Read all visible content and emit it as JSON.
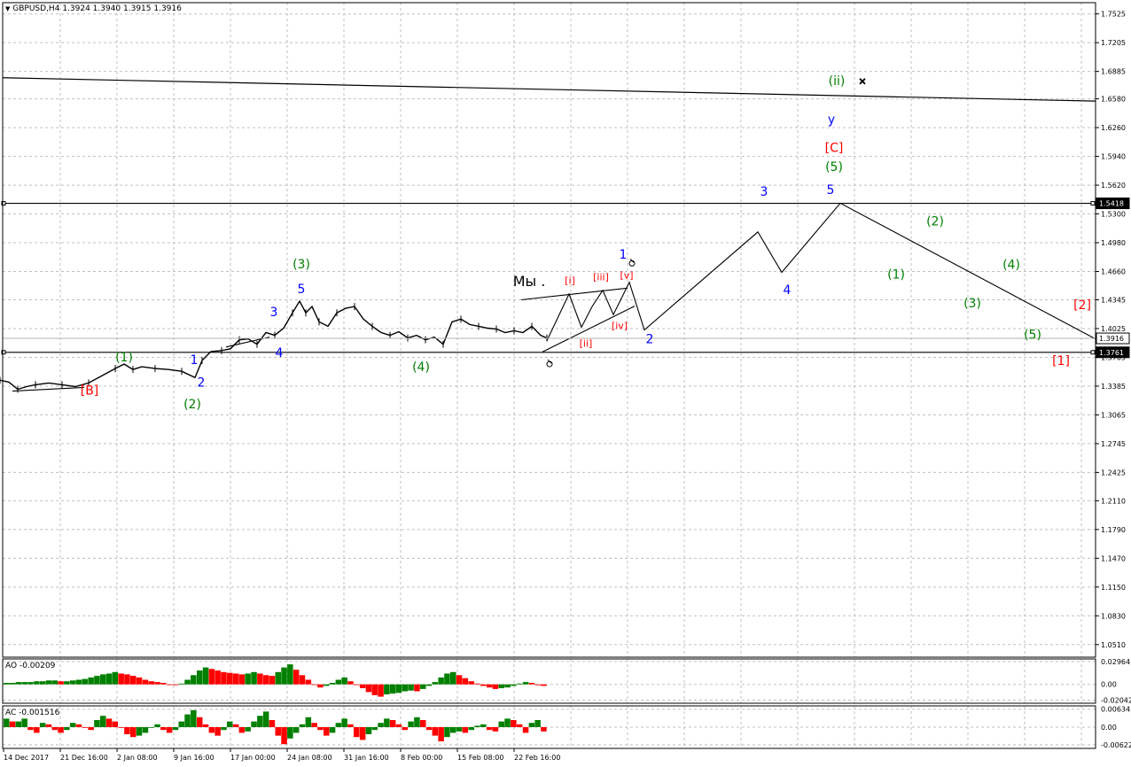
{
  "header": {
    "symbol": "GBPUSD,H4",
    "ohlc": "1.3924 1.3940 1.3915 1.3916"
  },
  "chart_data": [
    {
      "type": "line",
      "panel": "main",
      "ylim": [
        1.037,
        1.765
      ],
      "y_ticks": [
        "1.7525",
        "1.7205",
        "1.6885",
        "1.6580",
        "1.6260",
        "1.5940",
        "1.5620",
        "1.5300",
        "1.4980",
        "1.4660",
        "1.4345",
        "1.4025",
        "1.3705",
        "1.3385",
        "1.3065",
        "1.2745",
        "1.2425",
        "1.2110",
        "1.1790",
        "1.1470",
        "1.1150",
        "1.0830",
        "1.0510"
      ],
      "grid": true,
      "colors": {
        "background": "#ffffff",
        "grid": "#c0c0c0",
        "price": "#000000",
        "blue": "#0000ff",
        "green": "#008000",
        "red": "#ff0000"
      },
      "price_points": [
        [
          0,
          1.345
        ],
        [
          10,
          1.343
        ],
        [
          20,
          1.335
        ],
        [
          30,
          1.338
        ],
        [
          40,
          1.34
        ],
        [
          55,
          1.342
        ],
        [
          70,
          1.34
        ],
        [
          85,
          1.338
        ],
        [
          100,
          1.342
        ],
        [
          115,
          1.35
        ],
        [
          130,
          1.358
        ],
        [
          140,
          1.363
        ],
        [
          150,
          1.357
        ],
        [
          160,
          1.36
        ],
        [
          175,
          1.358
        ],
        [
          190,
          1.357
        ],
        [
          205,
          1.355
        ],
        [
          220,
          1.348
        ],
        [
          228,
          1.367
        ],
        [
          238,
          1.377
        ],
        [
          250,
          1.378
        ],
        [
          260,
          1.38
        ],
        [
          270,
          1.39
        ],
        [
          280,
          1.391
        ],
        [
          290,
          1.385
        ],
        [
          300,
          1.398
        ],
        [
          310,
          1.395
        ],
        [
          320,
          1.403
        ],
        [
          330,
          1.42
        ],
        [
          338,
          1.433
        ],
        [
          345,
          1.42
        ],
        [
          352,
          1.427
        ],
        [
          360,
          1.41
        ],
        [
          370,
          1.405
        ],
        [
          380,
          1.42
        ],
        [
          390,
          1.425
        ],
        [
          400,
          1.427
        ],
        [
          410,
          1.413
        ],
        [
          420,
          1.405
        ],
        [
          430,
          1.398
        ],
        [
          440,
          1.395
        ],
        [
          450,
          1.399
        ],
        [
          460,
          1.392
        ],
        [
          470,
          1.395
        ],
        [
          480,
          1.39
        ],
        [
          490,
          1.393
        ],
        [
          500,
          1.385
        ],
        [
          510,
          1.41
        ],
        [
          520,
          1.413
        ],
        [
          530,
          1.407
        ],
        [
          540,
          1.405
        ],
        [
          550,
          1.403
        ],
        [
          560,
          1.402
        ],
        [
          570,
          1.398
        ],
        [
          580,
          1.4
        ],
        [
          590,
          1.398
        ],
        [
          600,
          1.405
        ],
        [
          610,
          1.395
        ],
        [
          617,
          1.392
        ]
      ],
      "projection_path": [
        [
          617,
          1.389
        ],
        [
          642,
          1.441
        ],
        [
          656,
          1.404
        ],
        [
          668,
          1.427
        ],
        [
          680,
          1.445
        ],
        [
          692,
          1.418
        ],
        [
          710,
          1.454
        ],
        [
          727,
          1.401
        ],
        [
          855,
          1.51
        ],
        [
          882,
          1.465
        ],
        [
          948,
          1.542
        ],
        [
          1236,
          1.391
        ]
      ],
      "channel_lines": [
        [
          [
            588,
            1.4345
          ],
          [
            708,
            1.4475
          ]
        ],
        [
          [
            612,
            1.3765
          ],
          [
            716,
            1.4275
          ]
        ],
        [
          [
            14,
            1.333
          ],
          [
            95,
            1.337
          ]
        ],
        [
          [
            255,
            1.382
          ],
          [
            304,
            1.393
          ]
        ]
      ],
      "long_trend_line": [
        [
          3,
          1.6815
        ],
        [
          1236,
          1.6555
        ]
      ],
      "horizontal_levels": [
        {
          "value": 1.5418,
          "label": "1.5418",
          "style": "dark"
        },
        {
          "value": 1.3916,
          "label": "1.3916",
          "style": "current"
        },
        {
          "value": 1.3761,
          "label": "1.3761",
          "style": "dark"
        }
      ],
      "wave_labels": [
        {
          "text": "[B]",
          "color": "red",
          "x": 101,
          "y": 1.333
        },
        {
          "text": "(1)",
          "color": "green",
          "x": 140,
          "y": 1.37
        },
        {
          "text": "(2)",
          "color": "green",
          "x": 217,
          "y": 1.318
        },
        {
          "text": "1",
          "color": "blue",
          "x": 219,
          "y": 1.367
        },
        {
          "text": "2",
          "color": "blue",
          "x": 227,
          "y": 1.342
        },
        {
          "text": "3",
          "color": "blue",
          "x": 309,
          "y": 1.42
        },
        {
          "text": "4",
          "color": "blue",
          "x": 315,
          "y": 1.375
        },
        {
          "text": "5",
          "color": "blue",
          "x": 340,
          "y": 1.446
        },
        {
          "text": "(3)",
          "color": "green",
          "x": 340,
          "y": 1.4735
        },
        {
          "text": "(4)",
          "color": "green",
          "x": 475,
          "y": 1.359
        },
        {
          "text": "Мы .",
          "color": "black",
          "x": 597,
          "y": 1.454
        },
        {
          "text": "[i]",
          "color": "red",
          "x": 643,
          "y": 1.455
        },
        {
          "text": "[iii]",
          "color": "red",
          "x": 678,
          "y": 1.459
        },
        {
          "text": "[v]",
          "color": "red",
          "x": 707,
          "y": 1.461
        },
        {
          "text": "[iv]",
          "color": "red",
          "x": 699,
          "y": 1.405
        },
        {
          "text": "[ii]",
          "color": "red",
          "x": 661,
          "y": 1.385
        },
        {
          "text": "1",
          "color": "blue",
          "x": 703,
          "y": 1.484
        },
        {
          "text": "2",
          "color": "blue",
          "x": 733,
          "y": 1.39
        },
        {
          "text": "3",
          "color": "blue",
          "x": 862,
          "y": 1.554
        },
        {
          "text": "4",
          "color": "blue",
          "x": 888,
          "y": 1.445
        },
        {
          "text": "5",
          "color": "blue",
          "x": 937,
          "y": 1.556
        },
        {
          "text": "(5)",
          "color": "green",
          "x": 941,
          "y": 1.582
        },
        {
          "text": "[C]",
          "color": "red",
          "x": 941,
          "y": 1.603
        },
        {
          "text": "y",
          "color": "blue",
          "x": 938,
          "y": 1.6345
        },
        {
          "text": "(ii)",
          "color": "green",
          "x": 944,
          "y": 1.6775
        },
        {
          "text": "(1)",
          "color": "green",
          "x": 1011,
          "y": 1.462
        },
        {
          "text": "(2)",
          "color": "green",
          "x": 1055,
          "y": 1.521
        },
        {
          "text": "(3)",
          "color": "green",
          "x": 1097,
          "y": 1.43
        },
        {
          "text": "(4)",
          "color": "green",
          "x": 1141,
          "y": 1.473
        },
        {
          "text": "(5)",
          "color": "green",
          "x": 1165,
          "y": 1.395
        },
        {
          "text": "[2]",
          "color": "red",
          "x": 1221,
          "y": 1.428
        },
        {
          "text": "[1]",
          "color": "red",
          "x": 1197,
          "y": 1.366
        }
      ],
      "markers": [
        {
          "type": "cross",
          "x": 973,
          "y": 1.6775
        },
        {
          "type": "flag",
          "x": 713,
          "y": 1.475
        },
        {
          "type": "flag",
          "x": 620,
          "y": 1.363
        }
      ]
    },
    {
      "type": "bar",
      "panel": "AO",
      "title": "AO -0.00209",
      "ylim": [
        -0.0245,
        0.033
      ],
      "y_ticks": [
        "0.02964",
        "0.00",
        "-0.02042"
      ],
      "colors": {
        "up": "#008000",
        "down": "#ff0000"
      },
      "values": [
        0.002,
        0.002,
        0.003,
        0.003,
        0.003,
        0.004,
        0.004,
        0.005,
        0.005,
        0.004,
        0.004,
        0.005,
        0.006,
        0.007,
        0.009,
        0.011,
        0.013,
        0.014,
        0.016,
        0.014,
        0.013,
        0.011,
        0.009,
        0.006,
        0.004,
        0.003,
        0.002,
        0.0,
        -0.001,
        0.001,
        0.006,
        0.012,
        0.018,
        0.022,
        0.02,
        0.018,
        0.016,
        0.015,
        0.014,
        0.013,
        0.014,
        0.016,
        0.014,
        0.012,
        0.011,
        0.016,
        0.022,
        0.026,
        0.019,
        0.012,
        0.006,
        0.0,
        -0.004,
        -0.002,
        0.002,
        0.006,
        0.009,
        0.004,
        0.0,
        -0.005,
        -0.01,
        -0.014,
        -0.016,
        -0.013,
        -0.012,
        -0.011,
        -0.009,
        -0.008,
        -0.009,
        -0.006,
        -0.002,
        0.003,
        0.009,
        0.014,
        0.016,
        0.012,
        0.008,
        0.004,
        0.001,
        -0.002,
        -0.004,
        -0.006,
        -0.005,
        -0.004,
        -0.002,
        0.001,
        0.003,
        0.002,
        -0.001,
        -0.002
      ],
      "x_range": [
        4,
        617
      ]
    },
    {
      "type": "bar",
      "panel": "AC",
      "title": "AC -0.001516",
      "ylim": [
        -0.0075,
        0.0075
      ],
      "y_ticks": [
        "0.006345",
        "0.00",
        "-0.00622"
      ],
      "colors": {
        "up": "#008000",
        "down": "#ff0000"
      },
      "values": [
        0.003,
        0.002,
        0.002,
        0.003,
        -0.001,
        -0.002,
        0.0015,
        0.001,
        -0.001,
        -0.002,
        -0.001,
        0.0015,
        0.001,
        0.0,
        -0.001,
        0.0025,
        0.004,
        0.003,
        0.002,
        0.0,
        -0.0025,
        -0.0035,
        -0.003,
        -0.002,
        0.0,
        0.001,
        -0.001,
        -0.002,
        -0.001,
        0.002,
        0.0045,
        0.006,
        0.0035,
        0.001,
        -0.002,
        -0.003,
        -0.001,
        0.002,
        0.001,
        -0.002,
        -0.0015,
        0.002,
        0.004,
        0.0055,
        0.0025,
        -0.003,
        -0.006,
        -0.004,
        -0.002,
        0.001,
        0.0035,
        0.0015,
        -0.001,
        -0.003,
        -0.002,
        0.0015,
        0.003,
        0.001,
        -0.0035,
        -0.0045,
        -0.0025,
        -0.001,
        0.0015,
        0.003,
        0.0025,
        0.001,
        -0.001,
        0.002,
        0.0035,
        0.0025,
        -0.001,
        -0.003,
        -0.005,
        -0.0035,
        -0.002,
        -0.0015,
        -0.002,
        -0.001,
        0.0005,
        0.001,
        -0.001,
        -0.0015,
        0.002,
        0.003,
        0.0025,
        0.001,
        -0.002,
        0.0015,
        0.0025,
        -0.0015
      ],
      "x_range": [
        4,
        617
      ]
    }
  ],
  "x_axis_labels": [
    "14 Dec 2017",
    "21 Dec 16:00",
    "2 Jan 08:00",
    "9 Jan 16:00",
    "17 Jan 00:00",
    "24 Jan 08:00",
    "31 Jan 16:00",
    "8 Feb 00:00",
    "15 Feb 08:00",
    "22 Feb 16:00"
  ]
}
